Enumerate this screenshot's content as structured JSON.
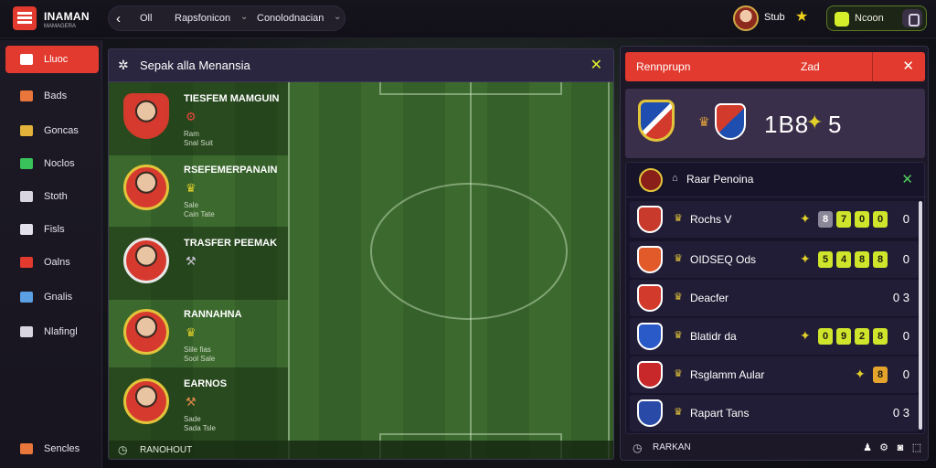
{
  "topbar": {
    "logo_text": "INAMAN",
    "logo_sub": "MAMAGERA",
    "crumbs": [
      "Oll",
      "Rapsfonicon",
      "Conolodnacian"
    ],
    "user_name": "Stub",
    "coin_label": "Ncoon"
  },
  "sidebar": {
    "items": [
      {
        "label": "Lluoc",
        "icon": "home-icon",
        "color": "#ffffff",
        "active": true
      },
      {
        "label": "Bads",
        "icon": "list-icon",
        "color": "#e9763a",
        "active": false
      },
      {
        "label": "Goncas",
        "icon": "trophy-icon",
        "color": "#e2b23a",
        "active": false
      },
      {
        "label": "Noclos",
        "icon": "flag-icon",
        "color": "#3ac25a",
        "active": false
      },
      {
        "label": "Stoth",
        "icon": "stats-icon",
        "color": "#d8d4e0",
        "active": false
      },
      {
        "label": "Fisls",
        "icon": "shield-icon",
        "color": "#e2e0ea",
        "active": false
      },
      {
        "label": "Oalns",
        "icon": "pen-icon",
        "color": "#e23a2e",
        "active": false
      },
      {
        "label": "Gnalis",
        "icon": "globe-icon",
        "color": "#5aa0e2",
        "active": false
      },
      {
        "label": "Nlafingl",
        "icon": "chat-icon",
        "color": "#d8d4e0",
        "active": false
      }
    ],
    "bottom": {
      "label": "Sencles",
      "icon": "settings-icon",
      "color": "#e9763a"
    }
  },
  "center": {
    "title": "Sepak alla Menansia",
    "footer": "RANOHOUT",
    "players": [
      {
        "name": "TIESFEM MAMGUIN",
        "badge": "⚙",
        "badge_color": "#e94a3a",
        "meta": [
          "Ram",
          "Snal Suit"
        ]
      },
      {
        "name": "RSEFEMERPANAIN",
        "badge": "♛",
        "badge_color": "#e2d02a",
        "meta": [
          "Sale",
          "Cain Tate"
        ]
      },
      {
        "name": "TRASFER PEEMAK",
        "badge": "⚒",
        "badge_color": "#c9c4d2",
        "meta": []
      },
      {
        "name": "RANNAHNA",
        "badge": "♛",
        "badge_color": "#e2d02a",
        "meta": [
          "Siile fias",
          "Sool Sale"
        ]
      },
      {
        "name": "EARNOS",
        "badge": "⚒",
        "badge_color": "#e28a4a",
        "meta": [
          "Sade",
          "Sada Tsle"
        ]
      }
    ]
  },
  "right": {
    "header_title": "Rennprupn",
    "header_mid": "Zad",
    "score_left": "1B8",
    "score_right": "5",
    "list_title": "Raar Penoina",
    "footer": "RARKAN",
    "rows": [
      {
        "name": "Rochs V",
        "crest_color": "#c83a2c",
        "cells": [
          "8",
          "7",
          "0",
          "0"
        ],
        "tail": "0",
        "pin": true
      },
      {
        "name": "OIDSEQ Ods",
        "crest_color": "#e25a2a",
        "cells": [
          "5",
          "4",
          "8",
          "8"
        ],
        "tail": "0",
        "pin": true
      },
      {
        "name": "Deacfer",
        "crest_color": "#d23a2c",
        "cells": [],
        "tail": "0 3",
        "pin": false
      },
      {
        "name": "Blatidr da",
        "crest_color": "#2a5ac8",
        "cells": [
          "0",
          "9",
          "2",
          "8"
        ],
        "tail": "0",
        "pin": true
      },
      {
        "name": "Rsglamm Aular",
        "crest_color": "#c8282a",
        "cells": [
          "8"
        ],
        "tail": "0",
        "pin": true
      },
      {
        "name": "Rapart Tans",
        "crest_color": "#2a4aa8",
        "cells": [],
        "tail": "0 3",
        "pin": false
      }
    ]
  }
}
